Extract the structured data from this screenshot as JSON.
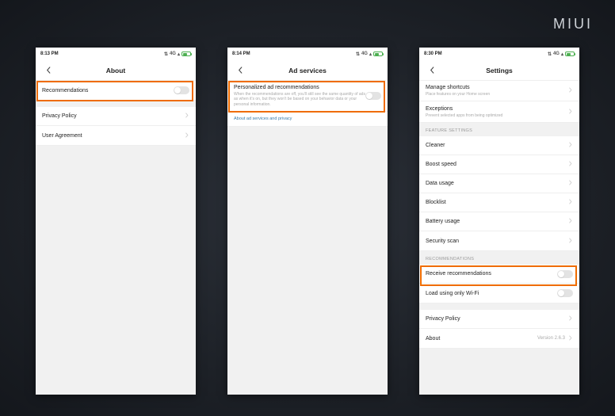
{
  "brand": "MIUI",
  "phone1": {
    "time": "8:13 PM",
    "signal": "4G",
    "title": "About",
    "rows": {
      "recommendations": "Recommendations",
      "privacy": "Privacy Policy",
      "agreement": "User Agreement"
    }
  },
  "phone2": {
    "time": "8:14 PM",
    "signal": "4G",
    "title": "Ad services",
    "recRow": {
      "main": "Personalized ad recommendations",
      "sub": "When the recommendations are off, you'll still see the same quantity of ads as when it's on, but they won't be based on your behavior data or your personal information."
    },
    "link": "About ad services and privacy"
  },
  "phone3": {
    "time": "8:30 PM",
    "signal": "4G",
    "title": "Settings",
    "rows": {
      "shortcuts": {
        "main": "Manage shortcuts",
        "sub": "Place features on your Home screen"
      },
      "exceptions": {
        "main": "Exceptions",
        "sub": "Prevent selected apps from being optimized"
      }
    },
    "sections": {
      "feature": "FEATURE SETTINGS",
      "recommendations": "RECOMMENDATIONS"
    },
    "featureItems": {
      "cleaner": "Cleaner",
      "boost": "Boost speed",
      "data": "Data usage",
      "blocklist": "Blocklist",
      "battery": "Battery usage",
      "security": "Security scan"
    },
    "recItems": {
      "receive": "Receive recommendations",
      "wifi": "Load using only Wi-Fi"
    },
    "bottom": {
      "privacy": "Privacy Policy",
      "about": "About",
      "version": "Version 2.6.3"
    }
  }
}
